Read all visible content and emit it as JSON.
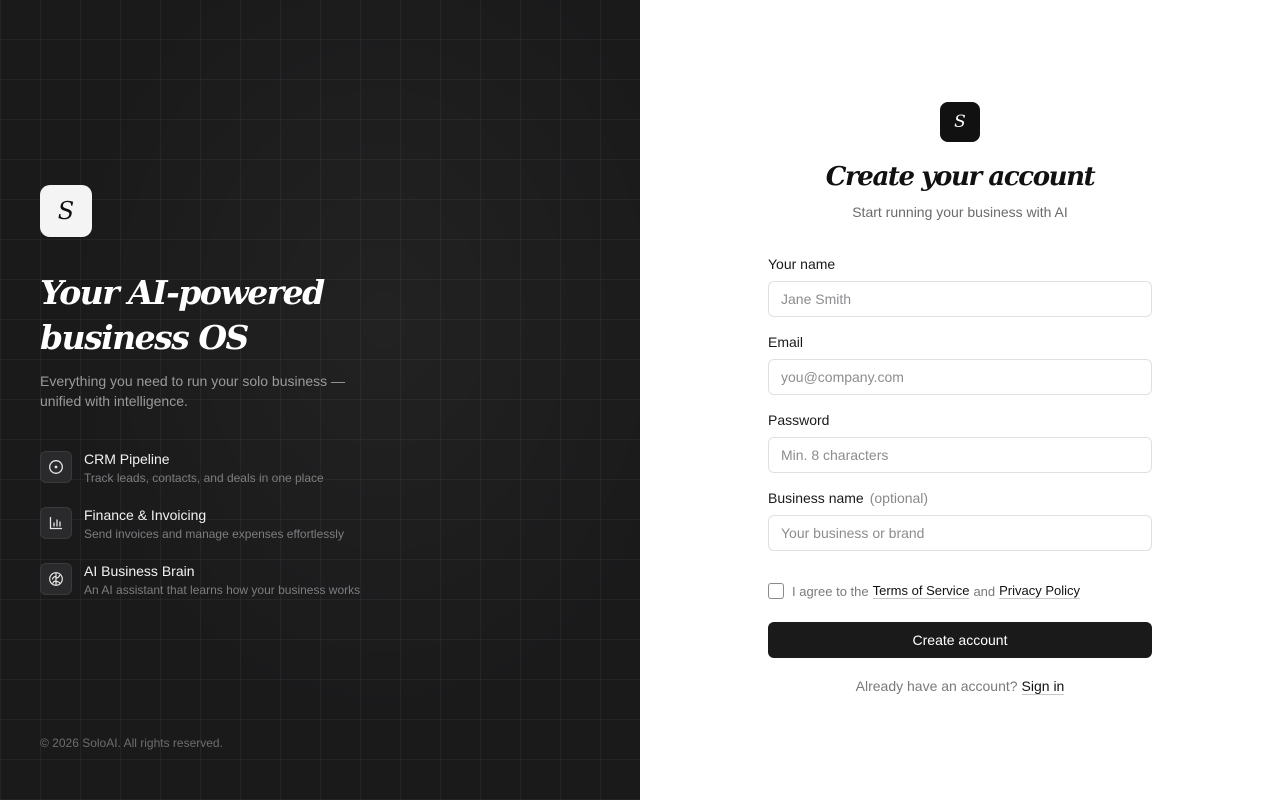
{
  "left": {
    "logo_letter": "S",
    "hero_line1": "Your AI-powered",
    "hero_line2": "business OS",
    "subtitle": "Everything you need to run your solo business — unified with intelligence.",
    "features": [
      {
        "icon": "target-icon",
        "title": "CRM Pipeline",
        "description": "Track leads, contacts, and deals in one place"
      },
      {
        "icon": "bar-chart-icon",
        "title": "Finance & Invoicing",
        "description": "Send invoices and manage expenses effortlessly"
      },
      {
        "icon": "brain-icon",
        "title": "AI Business Brain",
        "description": "An AI assistant that learns how your business works"
      }
    ],
    "copyright": "© 2026 SoloAI. All rights reserved."
  },
  "form": {
    "logo_letter": "S",
    "title": "Create your account",
    "subtitle": "Start running your business with AI",
    "name_label": "Your name",
    "name_placeholder": "Jane Smith",
    "name_value": "",
    "email_label": "Email",
    "email_placeholder": "you@company.com",
    "email_value": "",
    "password_label": "Password",
    "password_placeholder": "Min. 8 characters",
    "password_value": "",
    "business_label": "Business name",
    "business_optional": "(optional)",
    "business_placeholder": "Your business or brand",
    "business_value": "",
    "agree_prefix": "I agree to the",
    "terms_link": "Terms of Service",
    "agree_and": "and",
    "privacy_link": "Privacy Policy",
    "agree_checked": false,
    "submit_label": "Create account",
    "signin_prompt": "Already have an account?",
    "signin_link": "Sign in"
  },
  "colors": {
    "left_bg": "#1a1a1b",
    "primary_button": "#1a1a1b",
    "text_primary": "#111111",
    "text_muted": "#6b6b6e"
  }
}
